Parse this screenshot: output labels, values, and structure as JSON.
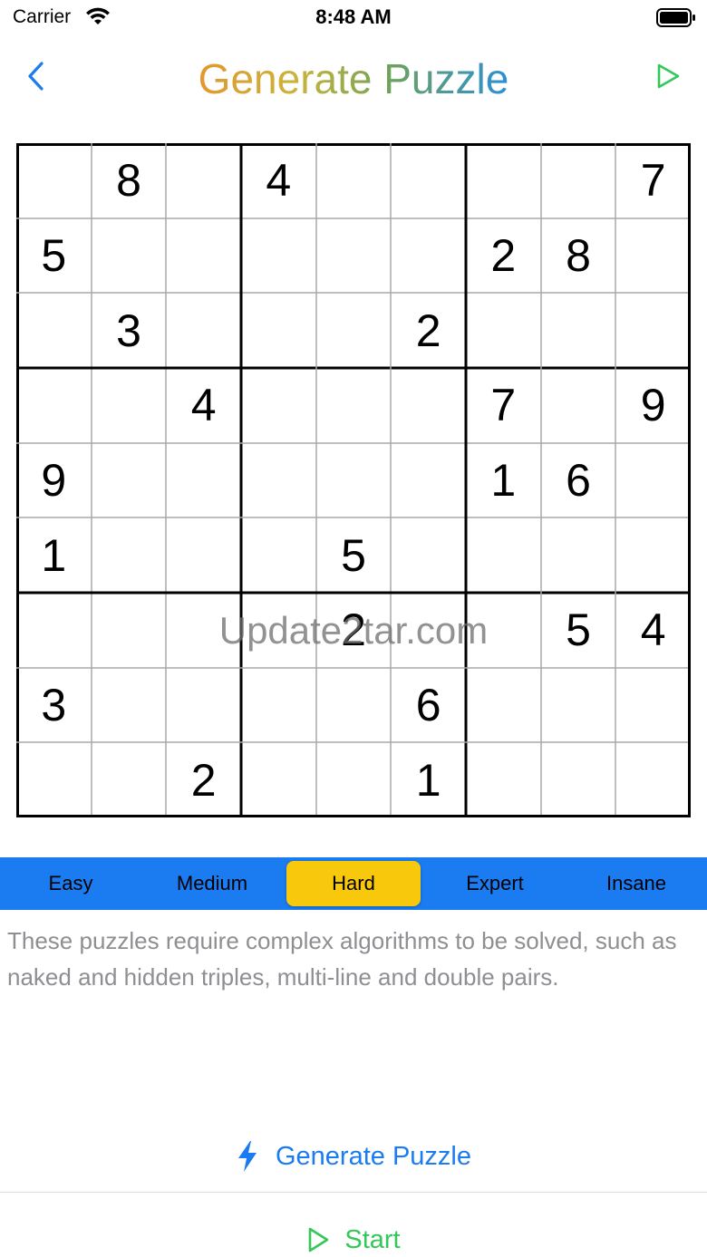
{
  "status": {
    "carrier": "Carrier",
    "time": "8:48 AM"
  },
  "nav": {
    "title": "Generate Puzzle"
  },
  "board": {
    "rows": [
      [
        "",
        "8",
        "",
        "4",
        "",
        "",
        "",
        "",
        "7"
      ],
      [
        "5",
        "",
        "",
        "",
        "",
        "",
        "2",
        "8",
        ""
      ],
      [
        "",
        "3",
        "",
        "",
        "",
        "2",
        "",
        "",
        ""
      ],
      [
        "",
        "",
        "4",
        "",
        "",
        "",
        "7",
        "",
        "9"
      ],
      [
        "9",
        "",
        "",
        "",
        "",
        "",
        "1",
        "6",
        ""
      ],
      [
        "1",
        "",
        "",
        "",
        "5",
        "",
        "",
        "",
        ""
      ],
      [
        "",
        "",
        "",
        "",
        "2",
        "",
        "",
        "5",
        "4"
      ],
      [
        "3",
        "",
        "",
        "",
        "",
        "6",
        "",
        "",
        ""
      ],
      [
        "",
        "",
        "2",
        "",
        "",
        "1",
        "",
        "",
        ""
      ]
    ]
  },
  "watermark": "Update2tar.com",
  "difficulty": {
    "options": [
      "Easy",
      "Medium",
      "Hard",
      "Expert",
      "Insane"
    ],
    "selected": "Hard"
  },
  "description": "These puzzles require complex algorithms to be solved, such as naked and hidden triples, multi-line and double pairs.",
  "actions": {
    "generate_label": "Generate Puzzle",
    "start_label": "Start"
  },
  "colors": {
    "accent": "#1a7cf0",
    "selected": "#f7c80c",
    "start": "#34c759",
    "description": "#8e8e93"
  },
  "icons": {
    "back": "chevron-left-icon",
    "play": "play-icon",
    "generate": "bolt-icon",
    "start": "play-icon"
  }
}
